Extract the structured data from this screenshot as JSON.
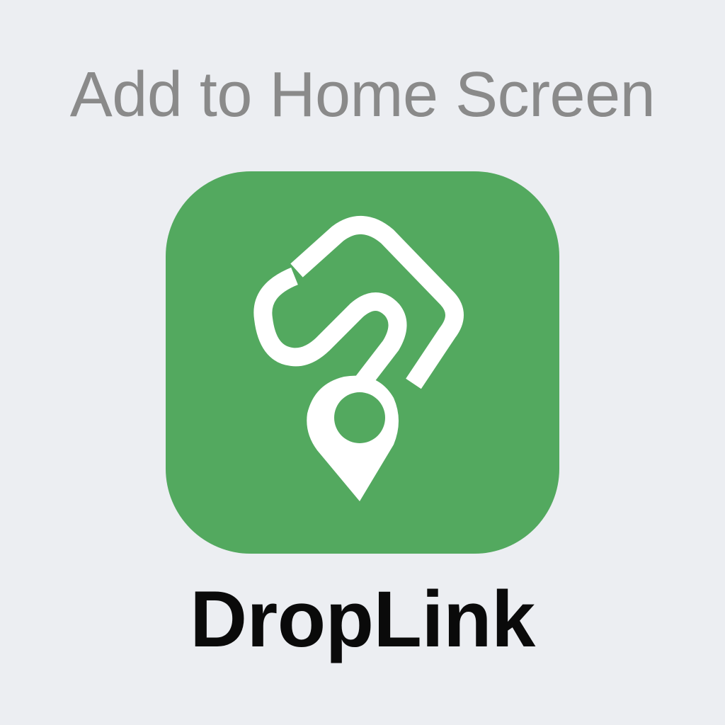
{
  "header": {
    "title": "Add to Home Screen"
  },
  "app": {
    "name": "DropLink",
    "icon": "route-pin-icon",
    "icon_background_color": "#53a95f",
    "icon_glyph_color": "#ffffff"
  },
  "colors": {
    "page_background": "#eceef2",
    "title_text": "#8a8a8a",
    "app_name_text": "#0a0a0a"
  }
}
